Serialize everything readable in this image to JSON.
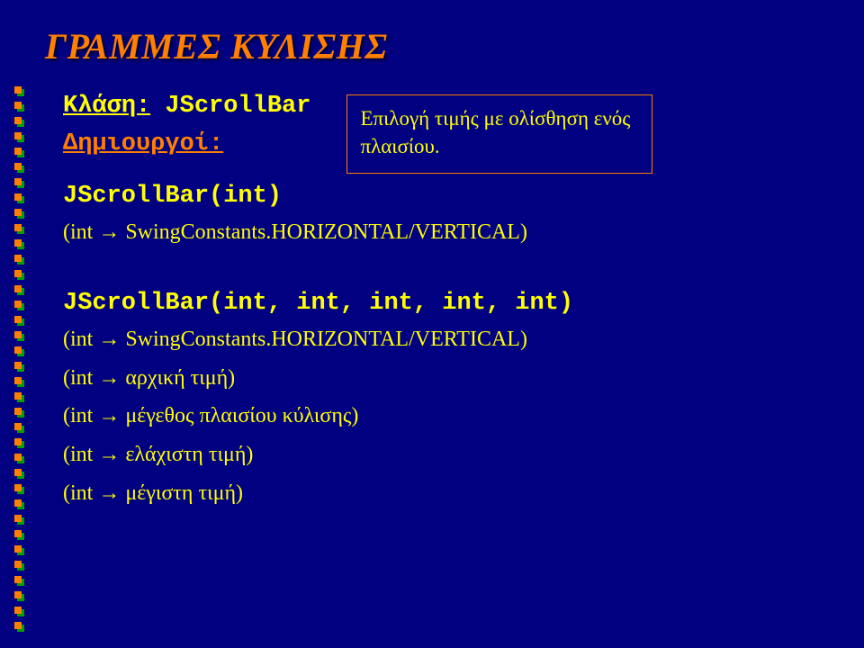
{
  "title": "ΓΡΑΜΜΕΣ ΚΥΛΙΣΗΣ",
  "klasi_prefix": "Κλάση:",
  "klasi_class": "JScrollBar",
  "dimiourgoi": "Δημιουργοί:",
  "tooltip": "Επιλογή τιμής με ολίσθηση ενός πλαισίου.",
  "ctor1": "JScrollBar(int)",
  "note1_a": "(int",
  "note1_b": "SwingConstants.HORIZONTAL/VERTICAL)",
  "ctor2": "JScrollBar(int, int, int, int, int)",
  "note2_a": "(int",
  "note2_b": "SwingConstants.HORIZONTAL/VERTICAL)",
  "note3_a": "(int",
  "note3_b": "αρχική τιμή)",
  "note4_a": "(int",
  "note4_b": "μέγεθος πλαισίου κύλισης)",
  "note5_a": "(int",
  "note5_b": "ελάχιστη τιμή)",
  "note6_a": "(int",
  "note6_b": "μέγιστη τιμή)",
  "arrow": "→"
}
